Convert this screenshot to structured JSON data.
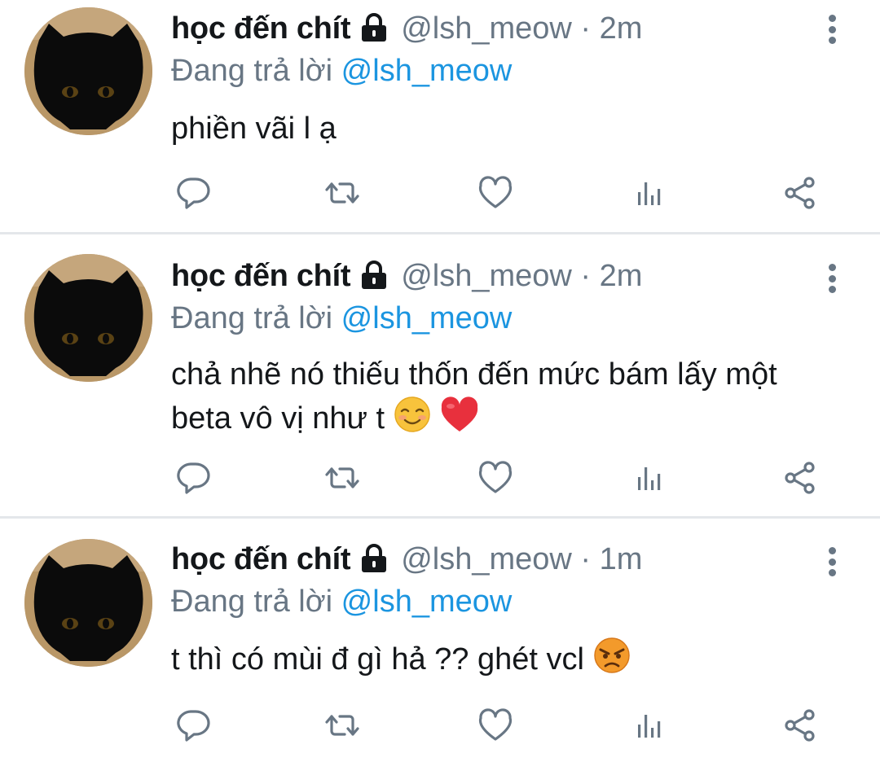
{
  "colors": {
    "text_primary": "#14171a",
    "text_secondary": "#687684",
    "mention_blue": "#1b95e0",
    "divider": "#e4e7ea"
  },
  "icons": [
    "lock-icon",
    "more-vertical-icon",
    "reply-icon",
    "retweet-icon",
    "like-icon",
    "analytics-icon",
    "share-icon"
  ],
  "tweets": [
    {
      "display_name": "học đến chít",
      "handle_time": "@lsh_meow · 2m",
      "reply_prefix": "Đang trả lời",
      "reply_mention": "@lsh_meow",
      "text": "phiền vãi l ạ"
    },
    {
      "display_name": "học đến chít",
      "handle_time": "@lsh_meow · 2m",
      "reply_prefix": "Đang trả lời",
      "reply_mention": "@lsh_meow",
      "text_line1": "chả nhẽ nó thiếu thốn đến mức bám lấy một",
      "text_line2": "beta vô vị như t"
    },
    {
      "display_name": "học đến chít",
      "handle_time": "@lsh_meow · 1m",
      "reply_prefix": "Đang trả lời",
      "reply_mention": "@lsh_meow",
      "text": "t thì có mùi đ gì hả ?? ghét vcl"
    }
  ]
}
